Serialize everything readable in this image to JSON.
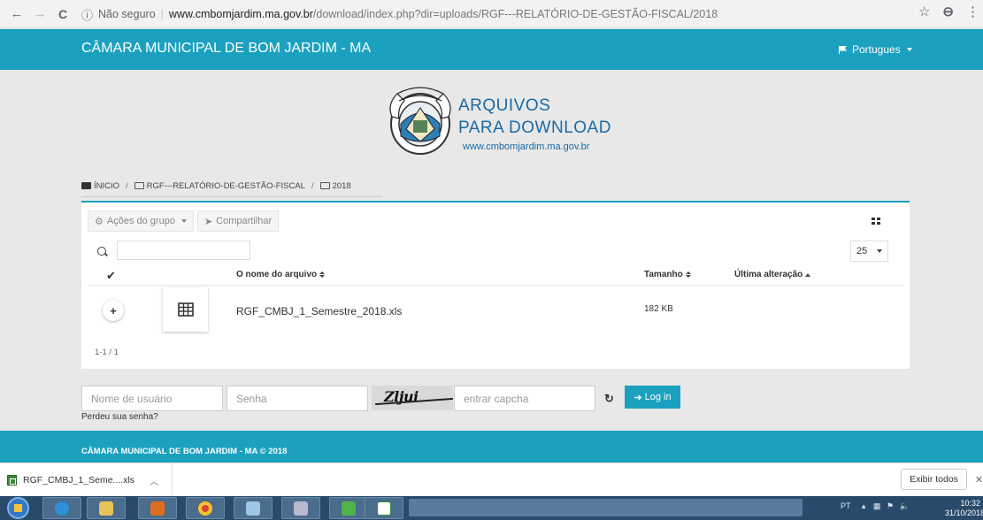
{
  "browser": {
    "back_icon": "←",
    "forward_icon": "→",
    "reload_icon": "C",
    "info_icon": "ⓘ",
    "security_text": "Não seguro",
    "separator": "|",
    "url_host": "www.cmbomjardim.ma.gov.br",
    "url_path": "/download/index.php?dir=uploads/RGF---RELATÓRIO-DE-GESTÃO-FISCAL/2018",
    "bookmark_icon": "☆",
    "account_icon": "⊖",
    "menu_icon": "⋮"
  },
  "header": {
    "title": "CÂMARA MUNICIPAL DE BOM JARDIM - MA",
    "language": "Portugues"
  },
  "logo": {
    "seal_text": "UNIÃO E TRABALHO",
    "line1": "ARQUIVOS",
    "line2": "PARA DOWNLOAD",
    "url": "www.cmbomjardim.ma.gov.br"
  },
  "breadcrumb": {
    "items": [
      "ÍNICIO",
      "RGF---RELATÓRIO-DE-GESTÃO-FISCAL",
      "2018"
    ],
    "separator": "/"
  },
  "toolbar": {
    "group_actions": "Ações do grupo",
    "share": "Compartilhar"
  },
  "search": {
    "value": ""
  },
  "per_page": "25",
  "table": {
    "columns": [
      "O nome do arquivo",
      "Tamanho",
      "Última alteração"
    ],
    "rows": [
      {
        "name": "RGF_CMBJ_1_Semestre_2018.xls",
        "size": "182 KB",
        "modified": ""
      }
    ],
    "add_symbol": "+",
    "pager": "1-1 / 1"
  },
  "login": {
    "username_placeholder": "Nome de usuário",
    "password_placeholder": "Senha",
    "captcha_text": "Zljui",
    "captcha_placeholder": "entrar capcha",
    "button": "Log in",
    "forgot": "Perdeu sua senha?"
  },
  "footer": {
    "text": "CÂMARA MUNICIPAL DE BOM JARDIM - MA © 2018"
  },
  "downloads": {
    "file": "RGF_CMBJ_1_Seme....xls",
    "show_all": "Exibir todos",
    "close": "✕"
  },
  "taskbar": {
    "lang": "PT",
    "time": "10:32",
    "date": "31/10/2018"
  },
  "colors": {
    "accent": "#1ba1bf",
    "logo_blue": "#1a6aa5"
  }
}
